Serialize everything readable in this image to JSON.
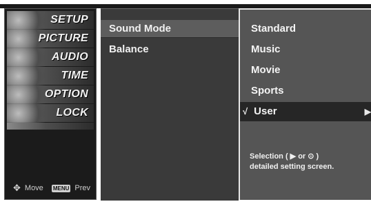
{
  "menu": {
    "items": [
      {
        "label": "SETUP",
        "icon": "satellite-dish-icon"
      },
      {
        "label": "PICTURE",
        "icon": "picture-icon"
      },
      {
        "label": "AUDIO",
        "icon": "speaker-icon"
      },
      {
        "label": "TIME",
        "icon": "clock-icon"
      },
      {
        "label": "OPTION",
        "icon": "option-icon"
      },
      {
        "label": "LOCK",
        "icon": "lock-icon"
      }
    ],
    "footer": {
      "move_label": "Move",
      "menu_key": "MENU",
      "prev_label": "Prev"
    }
  },
  "submenu": {
    "items": [
      {
        "label": "Sound Mode",
        "selected": true
      },
      {
        "label": "Balance",
        "selected": false
      }
    ]
  },
  "options": {
    "items": [
      {
        "label": "Standard"
      },
      {
        "label": "Music"
      },
      {
        "label": "Movie"
      },
      {
        "label": "Sports"
      },
      {
        "label": "User",
        "checked": true
      }
    ],
    "check_mark": "√",
    "arrow": "▶"
  },
  "help": {
    "line1": "Selection ( ▶ or ⊙ )",
    "line2": "detailed setting screen."
  }
}
